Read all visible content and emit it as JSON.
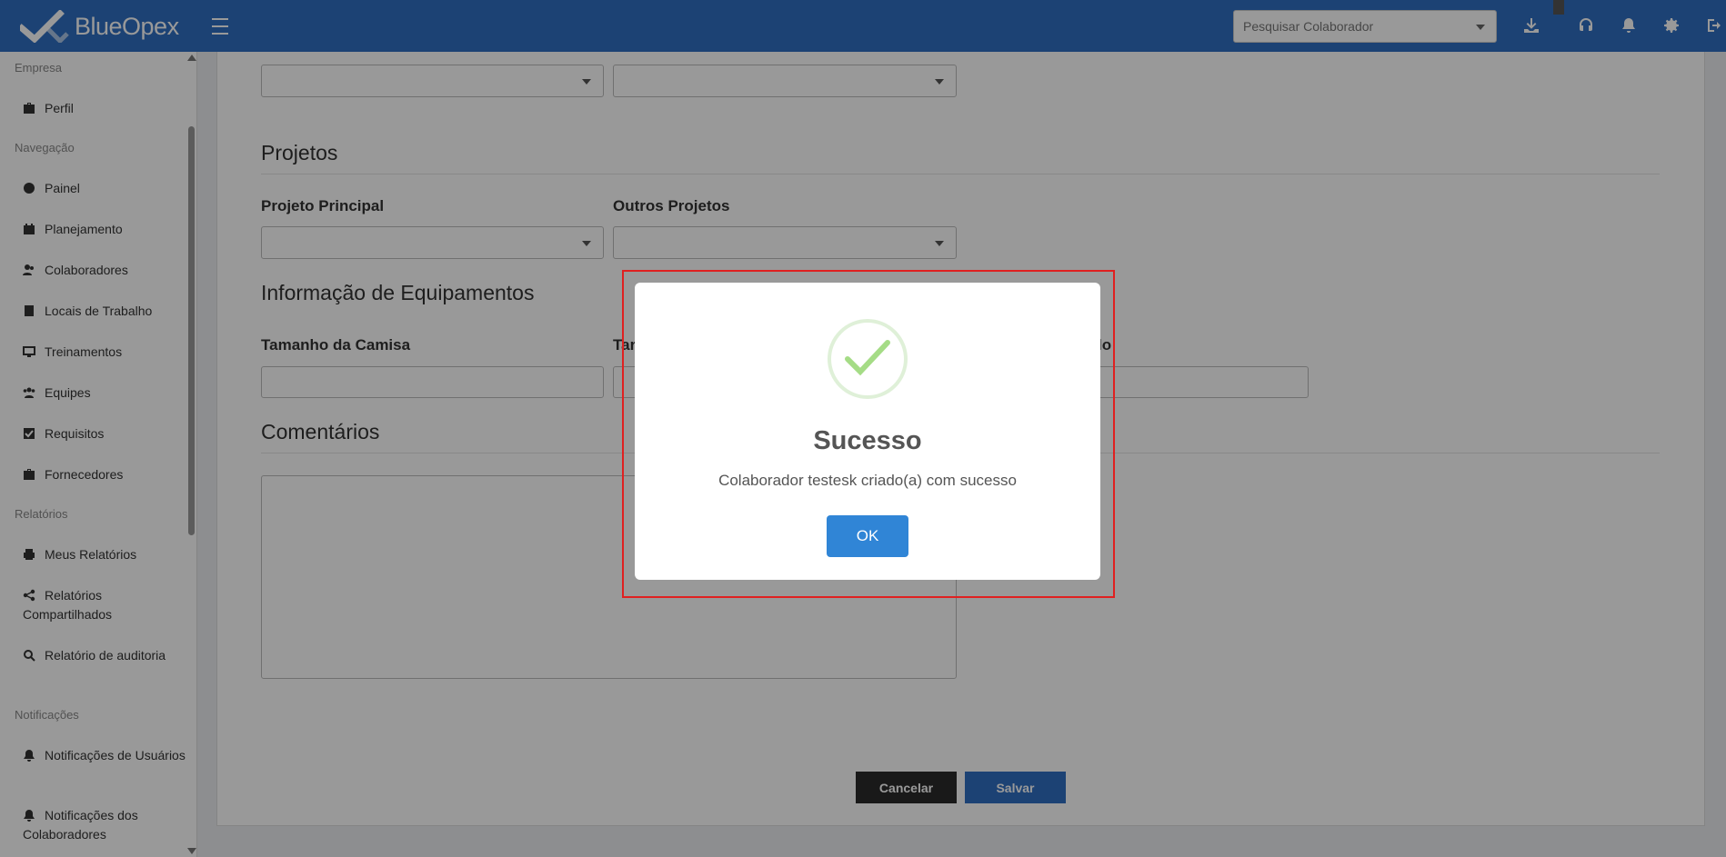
{
  "app": {
    "brand": "BlueOpex"
  },
  "topbar": {
    "search_placeholder": "Pesquisar Colaborador",
    "icons": [
      "download-icon",
      "headset-icon",
      "bell-icon",
      "gear-icon",
      "logout-icon"
    ]
  },
  "sidebar": {
    "sections": [
      {
        "label": "Empresa",
        "items": [
          {
            "label": "Perfil",
            "icon": "briefcase-icon"
          }
        ]
      },
      {
        "label": "Navegação",
        "items": [
          {
            "label": "Painel",
            "icon": "gauge-icon"
          },
          {
            "label": "Planejamento",
            "icon": "calendar-icon"
          },
          {
            "label": "Colaboradores",
            "icon": "users-icon"
          },
          {
            "label": "Locais de Trabalho",
            "icon": "building-icon"
          },
          {
            "label": "Treinamentos",
            "icon": "chalkboard-icon"
          },
          {
            "label": "Equipes",
            "icon": "team-icon"
          },
          {
            "label": "Requisitos",
            "icon": "checkbox-icon"
          },
          {
            "label": "Fornecedores",
            "icon": "briefcase-icon"
          }
        ]
      },
      {
        "label": "Relatórios",
        "items": [
          {
            "label": "Meus Relatórios",
            "icon": "printer-icon"
          },
          {
            "label": "Relatórios Compartilhados",
            "icon": "share-icon"
          },
          {
            "label": "Relatório de auditoria",
            "icon": "search-icon"
          }
        ]
      },
      {
        "label": "Notificações",
        "items": [
          {
            "label": "Notificações de Usuários",
            "icon": "bell-icon"
          },
          {
            "label": "Notificações dos Colaboradores",
            "icon": "bell-icon"
          }
        ]
      }
    ]
  },
  "form": {
    "projects_heading": "Projetos",
    "main_project_label": "Projeto Principal",
    "other_projects_label": "Outros Projetos",
    "equipment_heading": "Informação de Equipamentos",
    "shirt_size_label": "Tamanho da Camisa",
    "second_label_partial": "Tar",
    "third_label_partial": "lo",
    "comments_heading": "Comentários",
    "cancel_label": "Cancelar",
    "save_label": "Salvar"
  },
  "modal": {
    "title": "Sucesso",
    "message": "Colaborador testesk criado(a) com sucesso",
    "ok_label": "OK",
    "icon": "check-icon",
    "accent_color": "#3085d6",
    "success_color": "#a5dc86"
  }
}
